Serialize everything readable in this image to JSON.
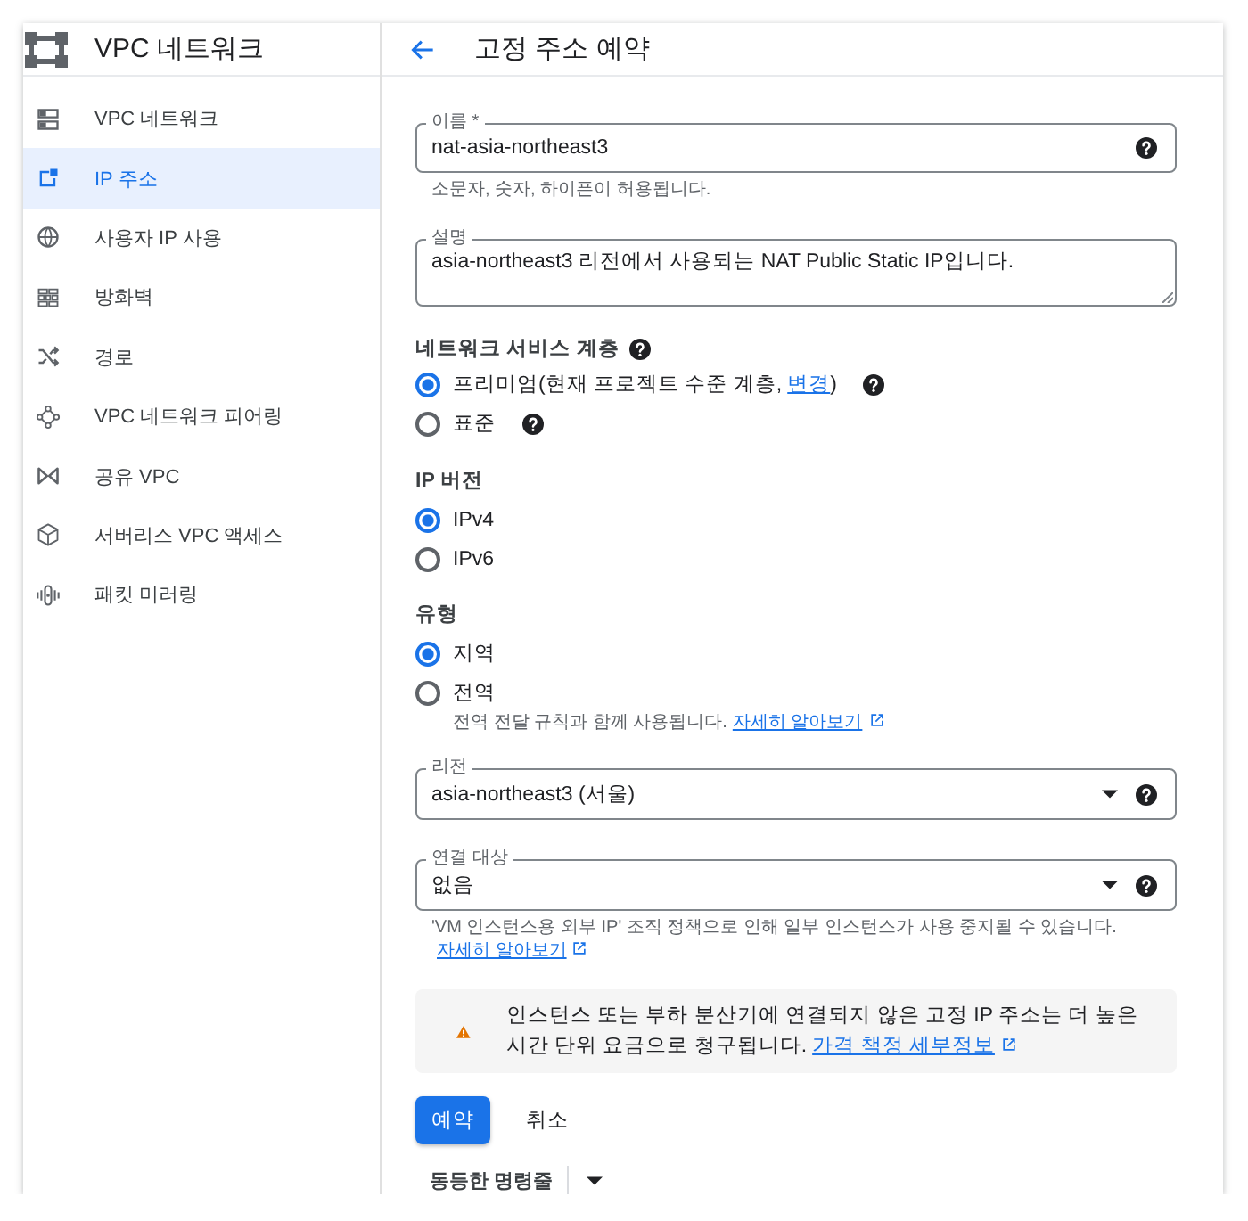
{
  "sidebar": {
    "title": "VPC 네트워크",
    "items": [
      {
        "label": "VPC 네트워크",
        "selected": false
      },
      {
        "label": "IP 주소",
        "selected": true
      },
      {
        "label": "사용자 IP 사용",
        "selected": false
      },
      {
        "label": "방화벽",
        "selected": false
      },
      {
        "label": "경로",
        "selected": false
      },
      {
        "label": "VPC 네트워크 피어링",
        "selected": false
      },
      {
        "label": "공유 VPC",
        "selected": false
      },
      {
        "label": "서버리스 VPC 액세스",
        "selected": false
      },
      {
        "label": "패킷 미러링",
        "selected": false
      }
    ]
  },
  "page": {
    "title": "고정 주소 예약"
  },
  "form": {
    "name": {
      "label": "이름 *",
      "value": "nat-asia-northeast3",
      "hint": "소문자, 숫자, 하이픈이 허용됩니다."
    },
    "description": {
      "label": "설명",
      "value": "asia-northeast3 리전에서 사용되는 NAT Public Static IP입니다."
    },
    "network_tier": {
      "label": "네트워크 서비스 계층",
      "options": [
        {
          "text": "프리미엄(현재 프로젝트 수준 계층,",
          "link": "변경",
          "text_after": ")",
          "selected": true
        },
        {
          "text": "표준",
          "selected": false
        }
      ]
    },
    "ip_version": {
      "label": "IP 버전",
      "options": [
        {
          "text": "IPv4",
          "selected": true
        },
        {
          "text": "IPv6",
          "selected": false
        }
      ]
    },
    "type": {
      "label": "유형",
      "options": [
        {
          "text": "지역",
          "selected": true
        },
        {
          "text": "전역",
          "selected": false,
          "hint": "전역 전달 규칙과 함께 사용됩니다.",
          "hint_link": "자세히 알아보기"
        }
      ]
    },
    "region": {
      "label": "리전",
      "value": "asia-northeast3 (서울)"
    },
    "attached_to": {
      "label": "연결 대상",
      "value": "없음",
      "hint": "'VM 인스턴스용 외부 IP' 조직 정책으로 인해 일부 인스턴스가 사용 중지될 수 있습니다.",
      "hint_link": "자세히 알아보기"
    }
  },
  "notice": {
    "text": "인스턴스 또는 부하 분산기에 연결되지 않은 고정 IP 주소는 더 높은 시간 단위 요금으로 청구됩니다.",
    "link": "가격 책정 세부정보"
  },
  "buttons": [
    {
      "label": "예약",
      "kind": "primary"
    },
    {
      "label": "취소",
      "kind": "text"
    }
  ],
  "command_line": {
    "label": "동등한 명령줄"
  }
}
